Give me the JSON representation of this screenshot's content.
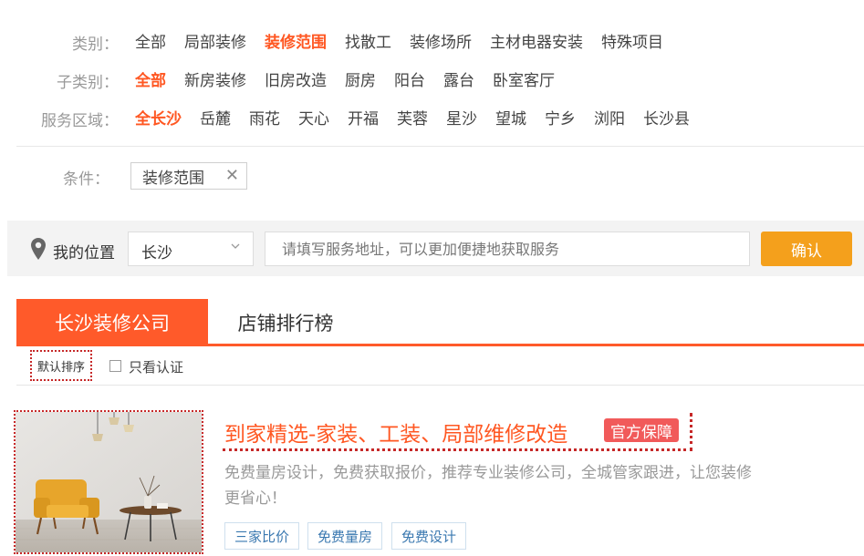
{
  "filters": {
    "category": {
      "label": "类别：",
      "items": [
        "全部",
        "局部装修",
        "装修范围",
        "找散工",
        "装修场所",
        "主材电器安装",
        "特殊项目"
      ],
      "active": 2
    },
    "subcategory": {
      "label": "子类别：",
      "items": [
        "全部",
        "新房装修",
        "旧房改造",
        "厨房",
        "阳台",
        "露台",
        "卧室客厅"
      ],
      "active": 0
    },
    "region": {
      "label": "服务区域：",
      "items": [
        "全长沙",
        "岳麓",
        "雨花",
        "天心",
        "开福",
        "芙蓉",
        "星沙",
        "望城",
        "宁乡",
        "浏阳",
        "长沙县"
      ],
      "active": 0
    }
  },
  "conditions": {
    "label": "条件：",
    "tag": "装修范围",
    "remove_symbol": "✕"
  },
  "location": {
    "label": "我的位置",
    "city": "长沙",
    "address_placeholder": "请填写服务地址，可以更加便捷地获取服务",
    "confirm": "确认"
  },
  "tabs": {
    "active": "长沙装修公司",
    "other": "店铺排行榜"
  },
  "sort": {
    "default": "默认排序",
    "certified_only": "只看认证"
  },
  "listing": {
    "title": "到家精选-家装、工装、局部维修改造",
    "badge": "官方保障",
    "description": "免费量房设计，免费获取报价，推荐专业装修公司，全城管家跟进，让您装修更省心！",
    "tags": [
      "三家比价",
      "免费量房",
      "免费设计"
    ]
  },
  "colors": {
    "accent": "#ff5722",
    "tab": "#ff5a2a",
    "confirm": "#f4a01c",
    "badge": "#f15a5a"
  }
}
